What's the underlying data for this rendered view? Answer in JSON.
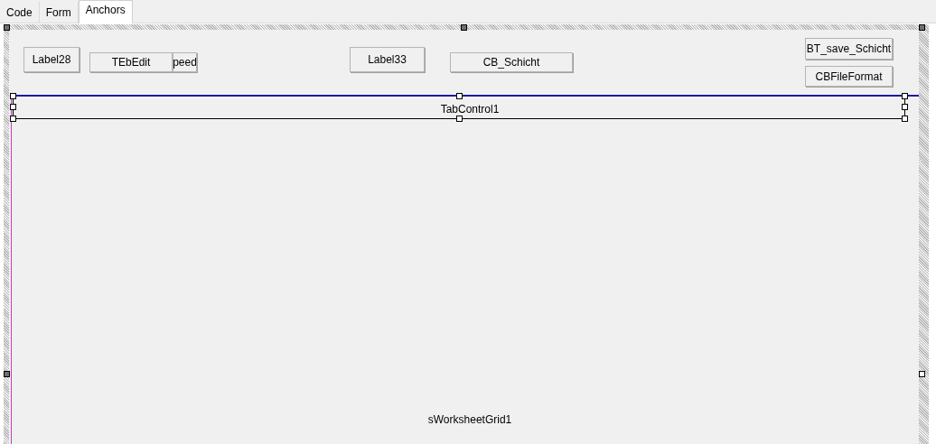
{
  "tabs": [
    {
      "label": "Code",
      "selected": false
    },
    {
      "label": "Form",
      "selected": false
    },
    {
      "label": "Anchors",
      "selected": true
    }
  ],
  "components": [
    {
      "kind": "panel",
      "text": "Label28"
    },
    {
      "kind": "panel",
      "text": "TEbEdit"
    },
    {
      "kind": "panel",
      "text": "peed"
    },
    {
      "kind": "panel",
      "text": "Label33"
    },
    {
      "kind": "panel",
      "text": "CB_Schicht"
    },
    {
      "kind": "panel",
      "text": "BT_save_Schicht"
    },
    {
      "kind": "panel",
      "text": "CBFileFormat"
    }
  ],
  "tab_control": {
    "label": "TabControl1"
  },
  "grid": {
    "label": "sWorksheetGrid1"
  }
}
